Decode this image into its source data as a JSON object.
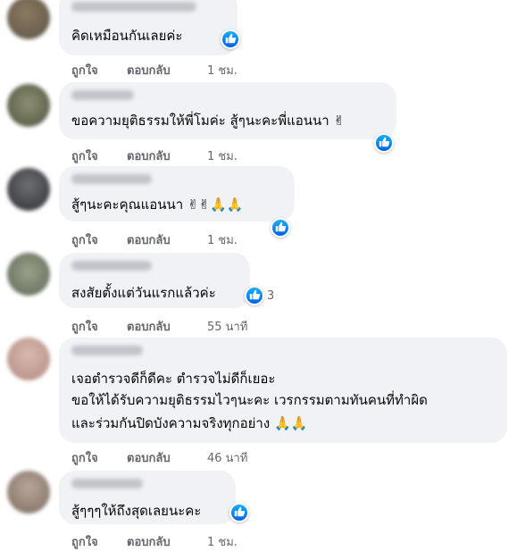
{
  "labels": {
    "like": "ถูกใจ",
    "reply": "ตอบกลับ"
  },
  "comments": [
    {
      "text": "คิดเหมือนกันเลยค่ะ",
      "time": "1 ชม."
    },
    {
      "text": "ขอความยุติธรรมให้พี่โมค่ะ สู้ๆนะคะพี่แอนนา ✌",
      "time": "1 ชม."
    },
    {
      "text": "สู้ๆนะคะคุณแอนนา ✌✌🙏🙏",
      "time": "1 ชม."
    },
    {
      "text": "สงสัยตั้งแต่วันแรกแล้วค่ะ",
      "time": "55 นาที",
      "reactions": "3"
    },
    {
      "lines": [
        "เจอตำรวจดีก็ดีคะ ตำรวจไม่ดีก็เยอะ",
        "ขอให้ได้รับความยุติธรรมไวๆนะคะ เวรกรรมตามทันคนที่ทำผิด",
        "และร่วมกันปิดบังความจริงทุกอย่าง 🙏🙏"
      ],
      "time": "46 นาที"
    },
    {
      "text": "สู้ๆๆๆให้ถึงสุดเลยนะคะ",
      "time": "1 ชม."
    }
  ]
}
